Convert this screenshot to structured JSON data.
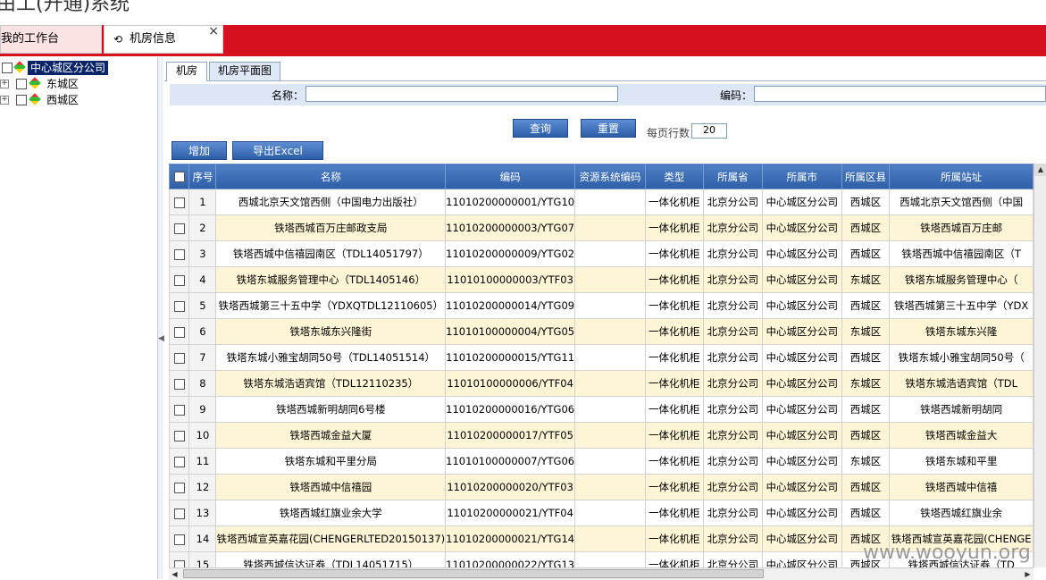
{
  "app": {
    "title": "由工(开通)系统"
  },
  "tabs": [
    {
      "label": "我的工作台"
    },
    {
      "label": "机房信息",
      "close": "×"
    }
  ],
  "tree": [
    {
      "label": "中心城区分公司",
      "selected": true
    },
    {
      "label": "东城区"
    },
    {
      "label": "西城区"
    }
  ],
  "subtabs": [
    {
      "label": "机房"
    },
    {
      "label": "机房平面图"
    }
  ],
  "search": {
    "name_label": "名称：",
    "code_label": "编码：",
    "name_value": "",
    "code_value": ""
  },
  "buttons": {
    "query": "查询",
    "reset": "重置",
    "add": "增加",
    "export": "导出Excel"
  },
  "pagesize": {
    "label": "每页行数",
    "value": "20"
  },
  "columns": [
    "",
    "序号",
    "名称",
    "编码",
    "资源系统编码",
    "类型",
    "所属省",
    "所属市",
    "所属区县",
    "所属站址"
  ],
  "rows": [
    [
      "1",
      "西城北京天文馆西侧（中国电力出版社）",
      "11010200000001/YTG10",
      "",
      "一体化机柜",
      "北京分公司",
      "中心城区分公司",
      "西城区",
      "西城北京天文馆西侧（中国"
    ],
    [
      "2",
      "铁塔西城百万庄邮政支局",
      "11010200000003/YTG07",
      "",
      "一体化机柜",
      "北京分公司",
      "中心城区分公司",
      "西城区",
      "铁塔西城百万庄邮"
    ],
    [
      "3",
      "铁塔西城中信禧园南区（TDL14051797）",
      "11010200000009/YTG02",
      "",
      "一体化机柜",
      "北京分公司",
      "中心城区分公司",
      "西城区",
      "铁塔西城中信禧园南区（T"
    ],
    [
      "4",
      "铁塔东城服务管理中心（TDL1405146）",
      "11010100000003/YTF03",
      "",
      "一体化机柜",
      "北京分公司",
      "中心城区分公司",
      "东城区",
      "铁塔东城服务管理中心（"
    ],
    [
      "5",
      "铁塔西城第三十五中学（YDXQTDL12110605）",
      "11010200000014/YTG09",
      "",
      "一体化机柜",
      "北京分公司",
      "中心城区分公司",
      "西城区",
      "铁塔西城第三十五中学（YDX"
    ],
    [
      "6",
      "铁塔东城东兴隆街",
      "11010100000004/YTG05",
      "",
      "一体化机柜",
      "北京分公司",
      "中心城区分公司",
      "东城区",
      "铁塔东城东兴隆"
    ],
    [
      "7",
      "铁塔东城小雅宝胡同50号（TDL14051514）",
      "11010200000015/YTG11",
      "",
      "一体化机柜",
      "北京分公司",
      "中心城区分公司",
      "西城区",
      "铁塔东城小雅宝胡同50号（"
    ],
    [
      "8",
      "铁塔东城浩语宾馆（TDL12110235）",
      "11010100000006/YTF04",
      "",
      "一体化机柜",
      "北京分公司",
      "中心城区分公司",
      "东城区",
      "铁塔东城浩语宾馆（TDL"
    ],
    [
      "9",
      "铁塔西城新明胡同6号楼",
      "11010200000016/YTG06",
      "",
      "一体化机柜",
      "北京分公司",
      "中心城区分公司",
      "西城区",
      "铁塔西城新明胡同"
    ],
    [
      "10",
      "铁塔西城金益大厦",
      "11010200000017/YTF05",
      "",
      "一体化机柜",
      "北京分公司",
      "中心城区分公司",
      "西城区",
      "铁塔西城金益大"
    ],
    [
      "11",
      "铁塔东城和平里分局",
      "11010100000007/YTG06",
      "",
      "一体化机柜",
      "北京分公司",
      "中心城区分公司",
      "东城区",
      "铁塔东城和平里"
    ],
    [
      "12",
      "铁塔西城中信禧园",
      "11010200000020/YTF03",
      "",
      "一体化机柜",
      "北京分公司",
      "中心城区分公司",
      "西城区",
      "铁塔西城中信禧"
    ],
    [
      "13",
      "铁塔西城红旗业余大学",
      "11010200000021/YTF04",
      "",
      "一体化机柜",
      "北京分公司",
      "中心城区分公司",
      "西城区",
      "铁塔西城红旗业余"
    ],
    [
      "14",
      "铁塔西城宣英嘉花园(CHENGERLTED20150137)",
      "11010200000021/YTG14",
      "",
      "一体化机柜",
      "北京分公司",
      "中心城区分公司",
      "西城区",
      "铁塔西城宣英嘉花园(CHENGE"
    ],
    [
      "15",
      "铁塔西城信达证券（TDL14051715）",
      "11010200000022/YTG13",
      "",
      "一体化机柜",
      "北京分公司",
      "中心城区分公司",
      "西城区",
      "铁塔西城信达证券（TD"
    ]
  ],
  "watermark": "www.wooyun.org"
}
